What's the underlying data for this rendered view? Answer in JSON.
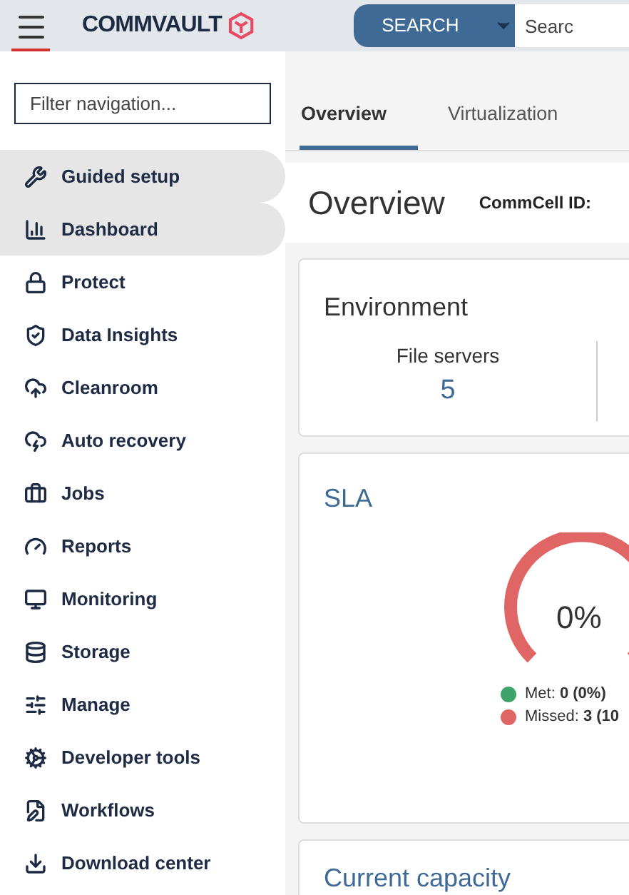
{
  "header": {
    "logo": "COMMVAULT",
    "search_button": "SEARCH",
    "search_placeholder": "Searc"
  },
  "sidebar": {
    "filter_placeholder": "Filter navigation...",
    "items": [
      {
        "label": "Guided setup",
        "highlighted": true
      },
      {
        "label": "Dashboard",
        "highlighted": true
      },
      {
        "label": "Protect",
        "highlighted": false
      },
      {
        "label": "Data Insights",
        "highlighted": false
      },
      {
        "label": "Cleanroom",
        "highlighted": false
      },
      {
        "label": "Auto recovery",
        "highlighted": false
      },
      {
        "label": "Jobs",
        "highlighted": false
      },
      {
        "label": "Reports",
        "highlighted": false
      },
      {
        "label": "Monitoring",
        "highlighted": false
      },
      {
        "label": "Storage",
        "highlighted": false
      },
      {
        "label": "Manage",
        "highlighted": false
      },
      {
        "label": "Developer tools",
        "highlighted": false
      },
      {
        "label": "Workflows",
        "highlighted": false
      },
      {
        "label": "Download center",
        "highlighted": false
      }
    ]
  },
  "tabs": [
    {
      "label": "Overview",
      "selected": true
    },
    {
      "label": "Virtualization",
      "selected": false
    }
  ],
  "page": {
    "title": "Overview",
    "commcell_label": "CommCell ID:"
  },
  "environment": {
    "title": "Environment",
    "stats": [
      {
        "label": "File servers",
        "value": "5"
      }
    ]
  },
  "sla": {
    "title": "SLA",
    "percent": "0%",
    "legend": [
      {
        "label": "Met: ",
        "value": "0 (0%)",
        "color": "#3fa46a"
      },
      {
        "label": "Missed: ",
        "value": "3 (10",
        "color": "#e06666"
      }
    ]
  },
  "capacity": {
    "title": "Current capacity"
  }
}
